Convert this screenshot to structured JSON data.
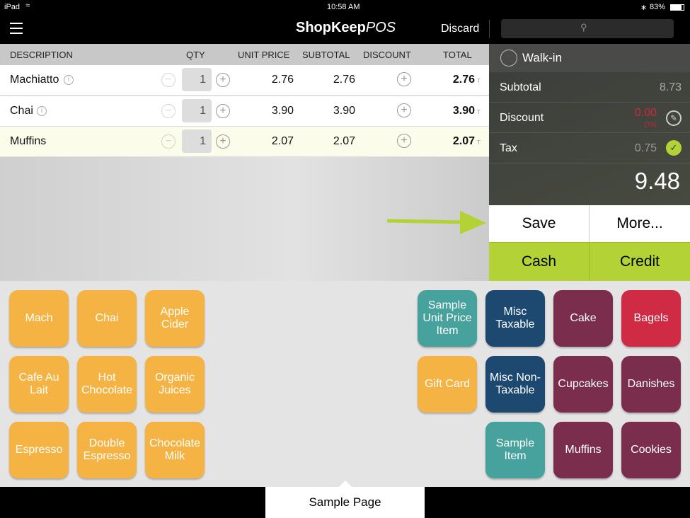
{
  "status": {
    "device": "iPad",
    "time": "10:58 AM",
    "battery": "83%"
  },
  "nav": {
    "logo_bold": "ShopKeep",
    "logo_light": "POS",
    "discard": "Discard",
    "search_placeholder": ""
  },
  "table": {
    "headers": [
      "DESCRIPTION",
      "QTY",
      "UNIT PRICE",
      "SUBTOTAL",
      "DISCOUNT",
      "TOTAL"
    ],
    "rows": [
      {
        "name": "Machiatto",
        "qty": "1",
        "unit": "2.76",
        "subtotal": "2.76",
        "total": "2.76",
        "tax": "T",
        "info": true
      },
      {
        "name": "Chai",
        "qty": "1",
        "unit": "3.90",
        "subtotal": "3.90",
        "total": "3.90",
        "tax": "T",
        "info": true
      },
      {
        "name": "Muffins",
        "qty": "1",
        "unit": "2.07",
        "subtotal": "2.07",
        "total": "2.07",
        "tax": "T",
        "info": false
      }
    ]
  },
  "summary": {
    "customer": "Walk-in",
    "subtotal_label": "Subtotal",
    "subtotal": "8.73",
    "discount_label": "Discount",
    "discount": "0.00",
    "discount_pct": "0%",
    "tax_label": "Tax",
    "tax": "0.75",
    "total": "9.48"
  },
  "actions": {
    "save": "Save",
    "more": "More...",
    "cash": "Cash",
    "credit": "Credit"
  },
  "colors": {
    "orange": "#f5b343",
    "teal": "#47a29d",
    "navy": "#1d4870",
    "plum": "#7a2d4c",
    "red": "#cf2b45",
    "accent": "#b3d235"
  },
  "tiles_left": [
    "Mach",
    "Chai",
    "Apple Cider",
    "Cafe Au Lait",
    "Hot Chocolate",
    "Organic Juices",
    "Espresso",
    "Double Espresso",
    "Chocolate Milk"
  ],
  "tiles_right": [
    {
      "label": "Sample Unit Price Item",
      "color": "teal"
    },
    {
      "label": "Misc Taxable",
      "color": "navy"
    },
    {
      "label": "Cake",
      "color": "plum"
    },
    {
      "label": "Bagels",
      "color": "red"
    },
    {
      "label": "Gift Card",
      "color": "orange"
    },
    {
      "label": "Misc Non-Taxable",
      "color": "navy"
    },
    {
      "label": "Cupcakes",
      "color": "plum"
    },
    {
      "label": "Danishes",
      "color": "plum"
    },
    {
      "label": "",
      "color": ""
    },
    {
      "label": "Sample Item",
      "color": "teal"
    },
    {
      "label": "Muffins",
      "color": "plum"
    },
    {
      "label": "Cookies",
      "color": "plum"
    }
  ],
  "page_tab": "Sample Page"
}
